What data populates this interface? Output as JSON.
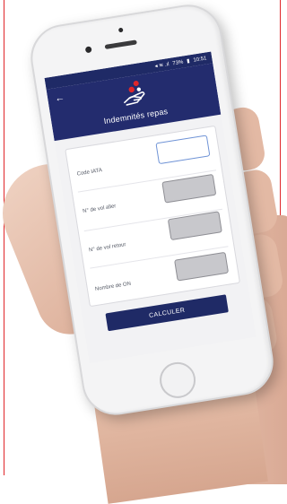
{
  "status_bar": {
    "icons_text": "◂ ≋ .ıl",
    "battery": "73%",
    "time": "10:51"
  },
  "header": {
    "back_icon": "arrow-left-icon",
    "logo_icon": "hand-with-dots-icon",
    "title": "Indemnités repas"
  },
  "form": {
    "fields": [
      {
        "label": "Code IATA",
        "value": "",
        "state": "active"
      },
      {
        "label": "N° de vol aller",
        "value": "",
        "state": "disabled"
      },
      {
        "label": "N° de vol retour",
        "value": "",
        "state": "disabled"
      },
      {
        "label": "Nombre de ON",
        "value": "",
        "state": "disabled"
      }
    ]
  },
  "actions": {
    "calculate_label": "CALCULER"
  },
  "colors": {
    "primary": "#232c6e",
    "accent_red": "#e0262a",
    "input_grey": "#c8c8cc"
  }
}
